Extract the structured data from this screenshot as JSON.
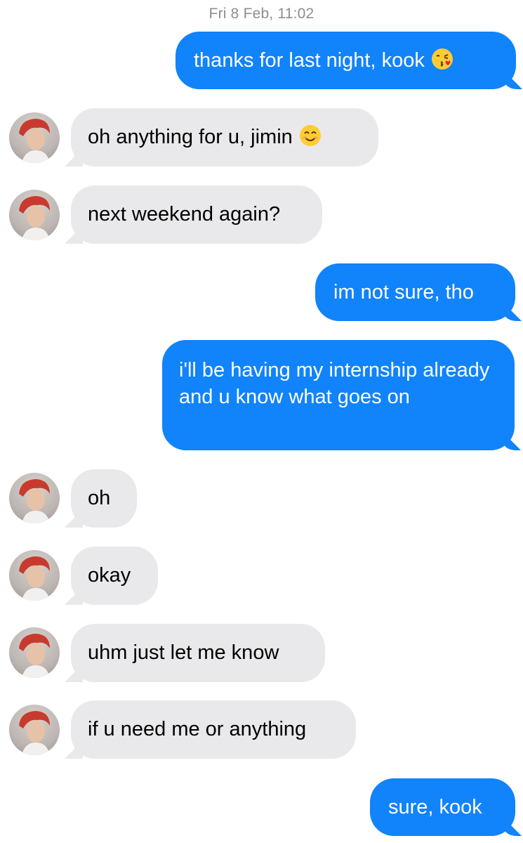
{
  "thread": {
    "timestamp": "Fri 8 Feb, 11:02",
    "messages": [
      {
        "direction": "sent",
        "text": "thanks for last night, kook",
        "emoji": "kissing-face-icon"
      },
      {
        "direction": "received",
        "text": "oh anything for u, jimin",
        "emoji": "smiling-face-icon"
      },
      {
        "direction": "received",
        "text": "next weekend again?"
      },
      {
        "direction": "sent",
        "text": "im not sure, tho"
      },
      {
        "direction": "sent",
        "text": "i'll be having my internship already and u know what goes on"
      },
      {
        "direction": "received",
        "text": "oh"
      },
      {
        "direction": "received",
        "text": "okay"
      },
      {
        "direction": "received",
        "text": "uhm just let me know"
      },
      {
        "direction": "received",
        "text": "if u need me or anything"
      },
      {
        "direction": "sent",
        "text": "sure, kook"
      }
    ]
  },
  "colors": {
    "sent_bubble": "#1183fb",
    "received_bubble": "#e9e9eb",
    "timestamp_text": "#8e8e93"
  }
}
